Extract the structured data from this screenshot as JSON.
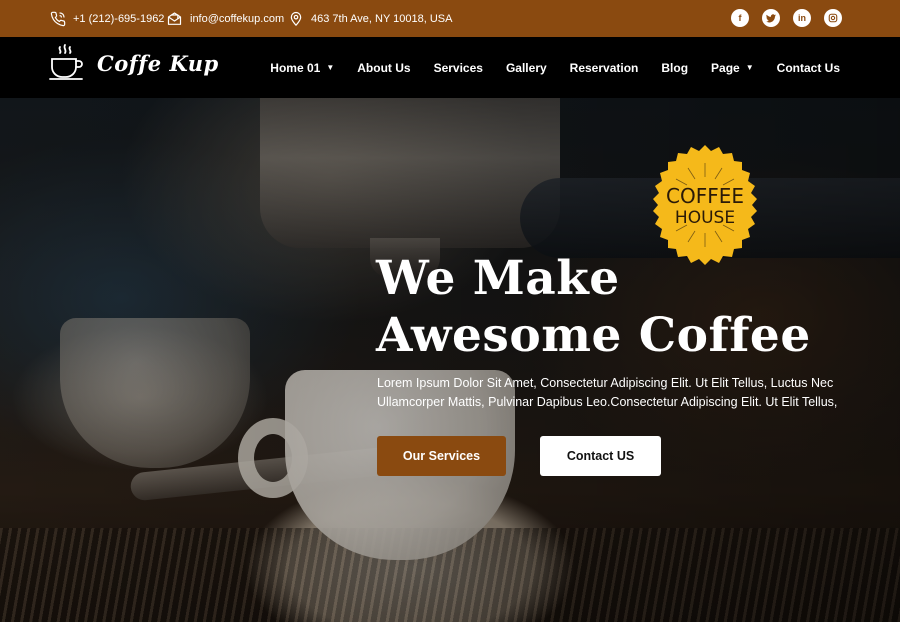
{
  "topbar": {
    "phone": "+1 (212)-695-1962",
    "email": "info@coffekup.com",
    "address": "463 7th Ave, NY 10018, USA",
    "socials": [
      {
        "icon": "facebook-icon",
        "glyph": "f"
      },
      {
        "icon": "twitter-icon",
        "glyph": "t"
      },
      {
        "icon": "linkedin-icon",
        "glyph": "in"
      },
      {
        "icon": "instagram-icon",
        "glyph": "◎"
      }
    ]
  },
  "nav": {
    "logo_text": "Coffe Kup",
    "items": [
      {
        "label": "Home 01",
        "has_dropdown": true
      },
      {
        "label": "About Us",
        "has_dropdown": false
      },
      {
        "label": "Services",
        "has_dropdown": false
      },
      {
        "label": "Gallery",
        "has_dropdown": false
      },
      {
        "label": "Reservation",
        "has_dropdown": false
      },
      {
        "label": "Blog",
        "has_dropdown": false
      },
      {
        "label": "Page",
        "has_dropdown": true
      },
      {
        "label": "Contact Us",
        "has_dropdown": false
      }
    ]
  },
  "hero": {
    "badge_line1": "COFFEE",
    "badge_line2": "HOUSE",
    "title_line1": "We Make",
    "title_line2": "Awesome Coffee",
    "text_line1": "Lorem Ipsum Dolor Sit Amet, Consectetur Adipiscing Elit. Ut Elit Tellus, Luctus Nec",
    "text_line2": "Ullamcorper Mattis, Pulvinar Dapibus Leo.Consectetur Adipiscing Elit. Ut Elit Tellus,",
    "primary_button": "Our Services",
    "secondary_button": "Contact US"
  },
  "colors": {
    "brand": "#8a4a10",
    "badge": "#f5b91a",
    "nav_bg": "#000000"
  }
}
